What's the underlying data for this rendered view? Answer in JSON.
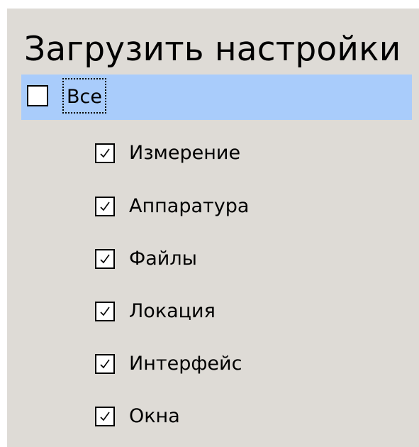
{
  "dialog": {
    "title": "Загрузить настройки"
  },
  "all_option": {
    "label": "Все",
    "checked": false,
    "highlight_color": "#a9ccfb"
  },
  "options": [
    {
      "label": "Измерение",
      "checked": true
    },
    {
      "label": "Аппаратура",
      "checked": true
    },
    {
      "label": "Файлы",
      "checked": true
    },
    {
      "label": "Локация",
      "checked": true
    },
    {
      "label": "Интерфейс",
      "checked": true
    },
    {
      "label": "Окна",
      "checked": true
    }
  ],
  "colors": {
    "panel_background": "#dedbd6",
    "text": "#000000"
  }
}
